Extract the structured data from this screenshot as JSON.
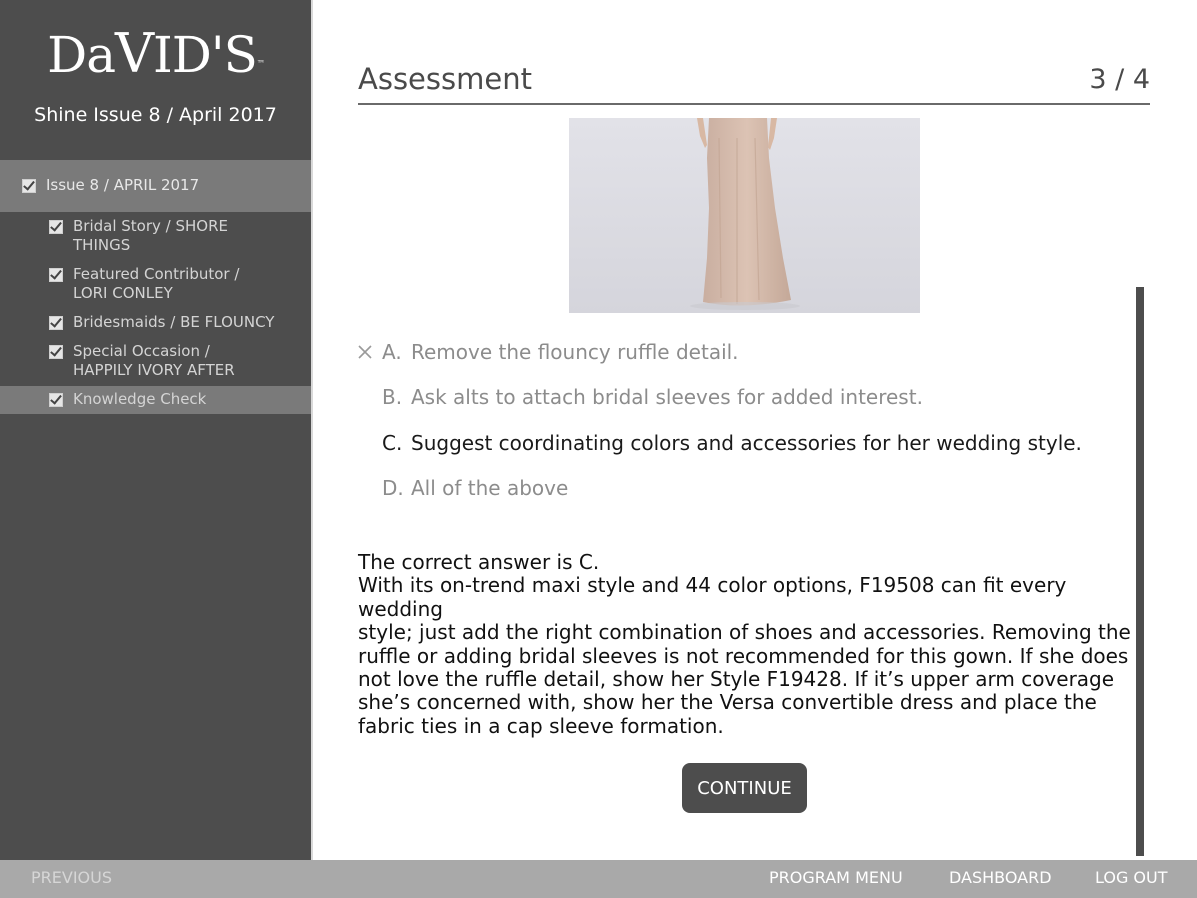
{
  "sidebar": {
    "logo_text": "DaVID'S",
    "subtitle": "Shine Issue 8 / April 2017",
    "section": {
      "label": "Issue 8 / APRIL 2017"
    },
    "items": [
      {
        "line1": "Bridal Story / SHORE",
        "line2": "THINGS"
      },
      {
        "line1": "Featured Contributor /",
        "line2": "LORI CONLEY"
      },
      {
        "line1": "Bridesmaids / BE FLOUNCY",
        "line2": ""
      },
      {
        "line1": "Special Occasion /",
        "line2": "HAPPILY IVORY AFTER"
      },
      {
        "line1": "Knowledge Check",
        "line2": ""
      }
    ]
  },
  "main": {
    "title": "Assessment",
    "page_counter": "3 / 4",
    "image_icon": "dress-photo",
    "options": [
      {
        "letter": "A.",
        "text": "Remove the flouncy ruffle detail.",
        "state": "wrong"
      },
      {
        "letter": "B.",
        "text": "Ask alts to attach bridal sleeves for added interest.",
        "state": "neutral"
      },
      {
        "letter": "C.",
        "text": "Suggest coordinating colors and accessories for her wedding style.",
        "state": "correct"
      },
      {
        "letter": "D.",
        "text": "All of the above",
        "state": "neutral"
      }
    ],
    "feedback": {
      "heading": "The correct answer is C.",
      "lines": [
        "With its on-trend maxi style and 44 color options, F19508 can fit every wedding",
        "style; just add the right combination of shoes and accessories. Removing the",
        "ruffle or adding bridal sleeves is not recommended for this gown. If she does",
        "not love the ruffle detail, show her Style F19428. If it’s upper arm coverage",
        "she’s concerned with, show her the Versa convertible dress and place the",
        "fabric ties in a cap sleeve formation."
      ]
    },
    "continue_label": "CONTINUE"
  },
  "footer": {
    "previous_label": "PREVIOUS",
    "program_menu_label": "PROGRAM MENU",
    "dashboard_label": "DASHBOARD",
    "logout_label": "LOG OUT"
  },
  "colors": {
    "sidebar_bg": "#4d4d4d",
    "sidebar_highlight": "#7a7a7a",
    "footer_bg": "#a9a9a9",
    "button_bg": "#4d4d4d"
  }
}
